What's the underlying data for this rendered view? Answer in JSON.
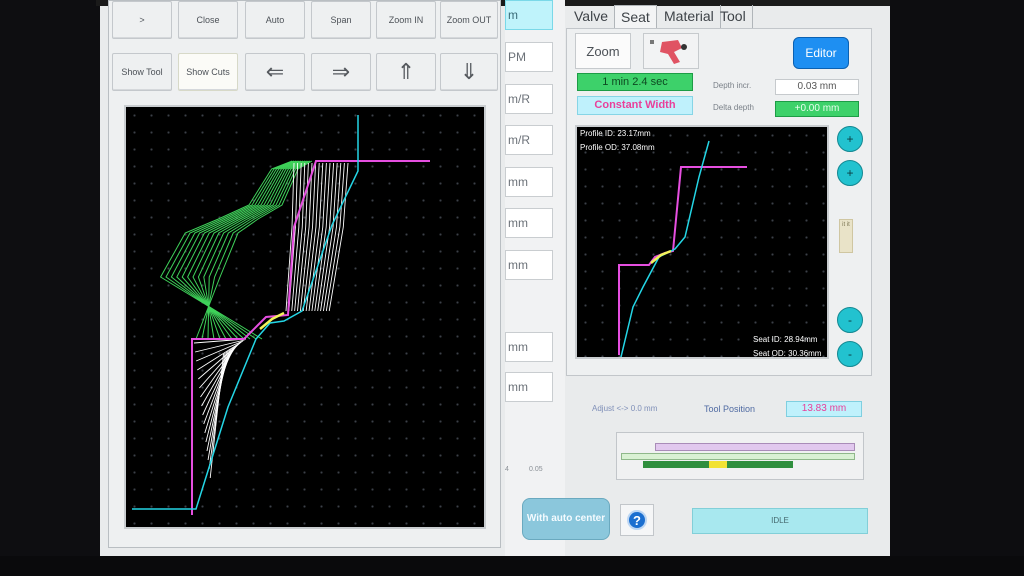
{
  "left_toolbar": {
    "row1": [
      ">",
      "Close",
      "Auto",
      "Span",
      "Zoom IN",
      "Zoom OUT"
    ],
    "row2": [
      "Show Tool",
      "Show Cuts"
    ],
    "arrows": {
      "left": "⇐",
      "right": "⇒",
      "up": "⇑",
      "down": "⇓"
    }
  },
  "middle_column": {
    "cells": [
      "m",
      "PM",
      "m/R",
      "m/R",
      "mm",
      "mm",
      "mm",
      "mm",
      "mm"
    ],
    "ticks": [
      "4",
      "0.05"
    ]
  },
  "tabs": [
    "Valve",
    "Seat",
    "Material",
    "Tool"
  ],
  "active_tab": "Seat",
  "seat_panel": {
    "zoom_label": "Zoom",
    "editor_label": "Editor",
    "time": "1 min 2.4 sec",
    "mode": "Constant Width",
    "depth_incr_label": "Depth incr.",
    "depth_incr_value": "0.03 mm",
    "delta_depth_label": "Delta depth",
    "delta_depth_value": "+0.00 mm",
    "profile_id": "Profile ID: 23.17mm",
    "profile_od": "Profile OD: 37.08mm",
    "seat_id": "Seat ID: 28.94mm",
    "seat_od": "Seat OD: 30.36mm",
    "side_badge": "it it",
    "buttons": {
      "plus1": "+",
      "plus2": "+",
      "minus1": "-",
      "minus2": "-"
    }
  },
  "bottom": {
    "adjust": "Adjust <-> 0.0 mm",
    "tool_position_label": "Tool Position",
    "tool_position_value": "13.83 mm",
    "auto_center": "With auto center",
    "help": "?",
    "status": "IDLE"
  },
  "colors": {
    "pink": "#e64fe0",
    "cyan": "#24d6e6",
    "green": "#3fd25a",
    "white": "#ffffff",
    "yellow": "#f2f25a",
    "editor_blue": "#1e8ff2"
  },
  "icons": {
    "tool_icon": "tool-icon",
    "help_icon": "question-icon"
  }
}
